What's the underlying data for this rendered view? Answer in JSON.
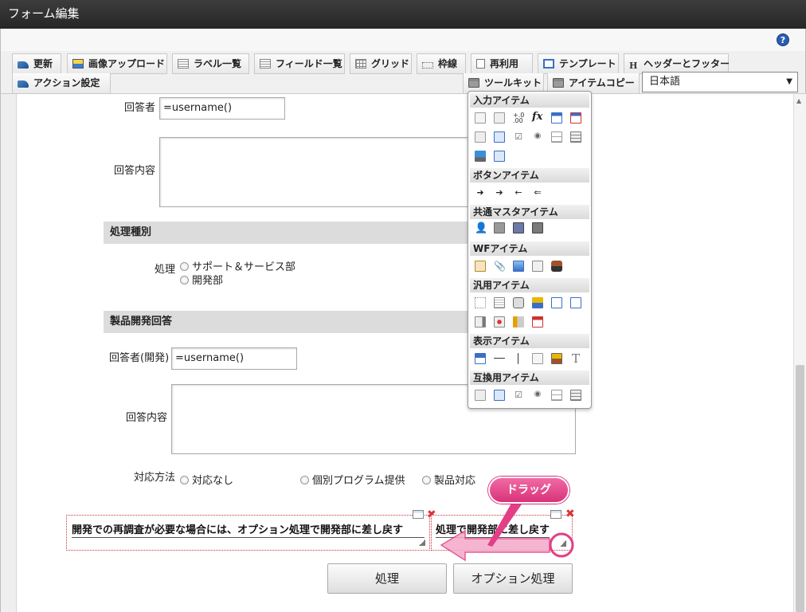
{
  "window": {
    "title": "フォーム編集"
  },
  "help": {
    "label": "?"
  },
  "toolbar": {
    "row1": [
      {
        "label": "更新",
        "icon": "refresh-icon"
      },
      {
        "label": "画像アップロード",
        "icon": "image-upload-icon"
      },
      {
        "label": "ラベル一覧",
        "icon": "label-list-icon"
      },
      {
        "label": "フィールド一覧",
        "icon": "field-list-icon"
      },
      {
        "label": "グリッド",
        "icon": "grid-icon"
      },
      {
        "label": "枠線",
        "icon": "border-icon"
      },
      {
        "label": "再利用",
        "icon": "reuse-icon"
      },
      {
        "label": "テンプレート",
        "icon": "template-icon"
      },
      {
        "label": "ヘッダーとフッター",
        "icon": "header-footer-icon"
      }
    ],
    "action_label": "アクション設定",
    "toolkit_label": "ツールキット",
    "item_copy_label": "アイテムコピー",
    "language": "日本語"
  },
  "form": {
    "respondent_label": "回答者",
    "respondent_value": "=username()",
    "answer_label": "回答内容",
    "section_process": "処理種別",
    "process_label": "処理",
    "process_options": [
      "サポート＆サービス部",
      "開発部"
    ],
    "section_product": "製品開発回答",
    "respondent_dev_label": "回答者(開発)",
    "respondent_dev_value": "=username()",
    "answer2_label": "回答内容",
    "response_label": "対応方法",
    "response_options": [
      "対応なし",
      "個別プログラム提供",
      "製品対応"
    ],
    "note_text": "開発での再調査が必要な場合には、オプション処理で開発部に差し戻す",
    "note_text_short": "処理で開発部に差し戻す",
    "buttons": {
      "process": "処理",
      "option_process": "オプション処理"
    }
  },
  "palette": {
    "sections": [
      "入力アイテム",
      "ボタンアイテム",
      "共通マスタアイテム",
      "WFアイテム",
      "汎用アイテム",
      "表示アイテム",
      "互換用アイテム"
    ]
  },
  "annotation": {
    "drag_label": "ドラッグ",
    "color": "#e23f86"
  }
}
